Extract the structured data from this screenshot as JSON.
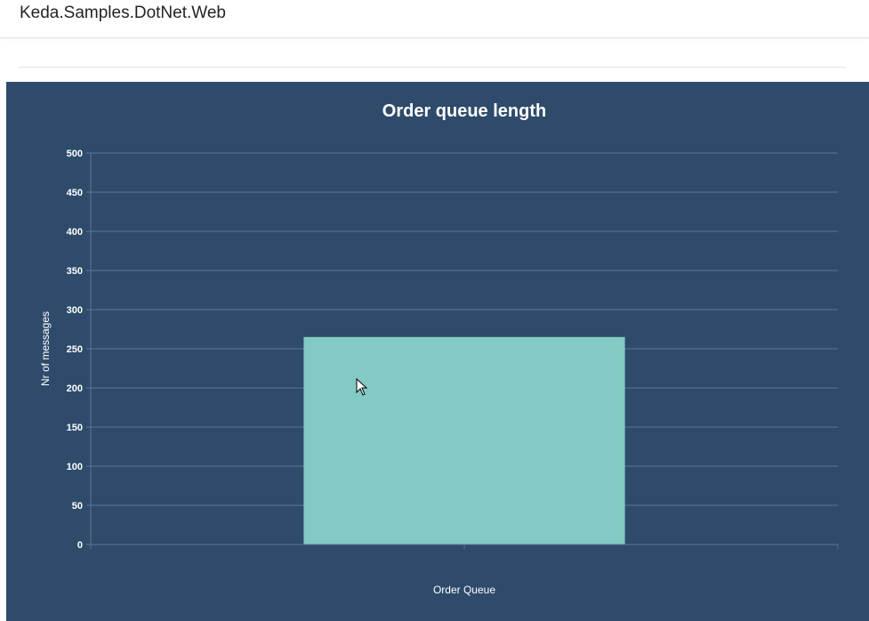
{
  "navbar": {
    "brand": "Keda.Samples.DotNet.Web"
  },
  "colors": {
    "chart_background": "#2f4b6b",
    "bar": "#82cac3",
    "text": "#ffffff",
    "gridline": "#5d7590"
  },
  "chart_data": {
    "type": "bar",
    "title": "Order queue length",
    "xlabel": "",
    "ylabel": "Nr of messages",
    "categories": [
      "Order Queue"
    ],
    "values": [
      265
    ],
    "ylim": [
      0,
      500
    ],
    "yticks": [
      0,
      50,
      100,
      150,
      200,
      250,
      300,
      350,
      400,
      450,
      500
    ],
    "grid": true
  }
}
